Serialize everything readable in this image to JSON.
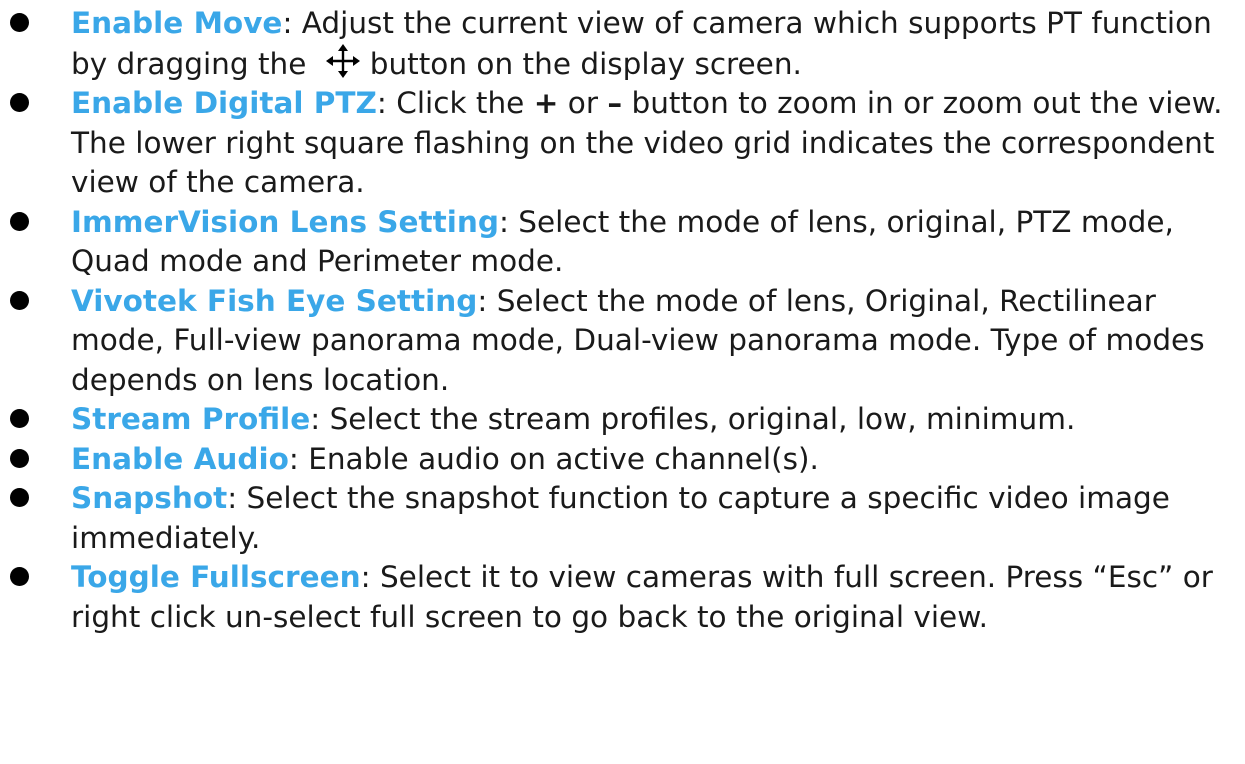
{
  "accent_color": "#3aa7e8",
  "items": [
    {
      "term": "Enable Move",
      "text_a": ": Adjust the current view of camera which supports PT function by dragging the",
      "icon": "move-arrows-icon",
      "text_b": "button on the display screen."
    },
    {
      "term": "Enable Digital PTZ",
      "text_a": ": Click the ",
      "plus": "+",
      "text_b": " or ",
      "minus": "–",
      "text_c": " button to zoom in or zoom out the view. The lower right square flashing on the video grid indicates the correspondent view of the camera."
    },
    {
      "term": "ImmerVision Lens Setting",
      "text": ": Select the mode of lens, original, PTZ mode, Quad mode and Perimeter mode."
    },
    {
      "term": "Vivotek Fish Eye Setting",
      "text": ": Select the mode of lens, Original, Rectilinear mode, Full-view panorama mode, Dual-view panorama mode. Type of modes depends on lens location."
    },
    {
      "term": "Stream Profile",
      "text": ": Select the stream profiles, original, low, minimum."
    },
    {
      "term": "Enable Audio",
      "text": ": Enable audio on active channel(s)."
    },
    {
      "term": "Snapshot",
      "text": ": Select the snapshot function to capture a specific video image immediately."
    },
    {
      "term": "Toggle Fullscreen",
      "text": ": Select it to view cameras with full screen. Press “Esc” or right click un-select full screen to go back to the original view."
    }
  ]
}
